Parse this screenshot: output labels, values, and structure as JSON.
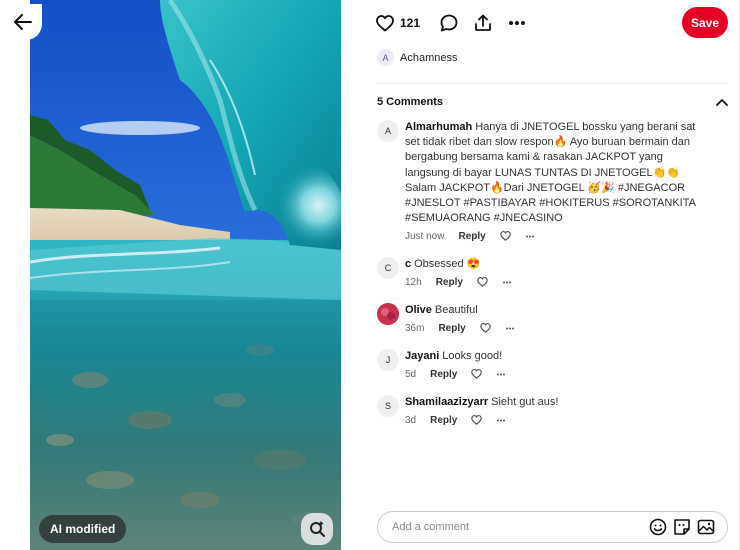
{
  "actions": {
    "like_count": "121",
    "save_label": "Save"
  },
  "author": {
    "initial": "A",
    "name": "Achamness"
  },
  "media": {
    "ai_badge": "AI modified"
  },
  "comments_header": {
    "title": "5 Comments"
  },
  "comments": [
    {
      "initial": "A",
      "user": "Almarhumah",
      "text": "Hanya di JNETOGEL bossku yang berani sat set tidak ribet dan slow respon🔥 Ayo buruan bermain dan bergabung bersama kami & rasakan JACKPOT yang langsung di bayar LUNAS TUNTAS DI JNETOGEL👏👏 Salam JACKPOT🔥Dari JNETOGEL 🥳🎉 #JNEGACOR #JNESLOT #PASTIBAYAR #HOKITERUS #SOROTANKITA #SEMUAORANG #JNECASINO",
      "time": "Just now",
      "reply": "Reply"
    },
    {
      "initial": "C",
      "user": "c",
      "text": "Obsessed 😍",
      "time": "12h",
      "reply": "Reply"
    },
    {
      "initial": "",
      "user": "Olive",
      "text": "Beautiful",
      "time": "36m",
      "reply": "Reply"
    },
    {
      "initial": "J",
      "user": "Jayani",
      "text": "Looks good!",
      "time": "5d",
      "reply": "Reply"
    },
    {
      "initial": "S",
      "user": "Shamilaazizyarr",
      "text": "Sieht gut aus!",
      "time": "3d",
      "reply": "Reply"
    }
  ],
  "add_comment": {
    "placeholder": "Add a comment"
  },
  "colors": {
    "save": "#e60023",
    "olive_avatar": "#c8324f"
  }
}
